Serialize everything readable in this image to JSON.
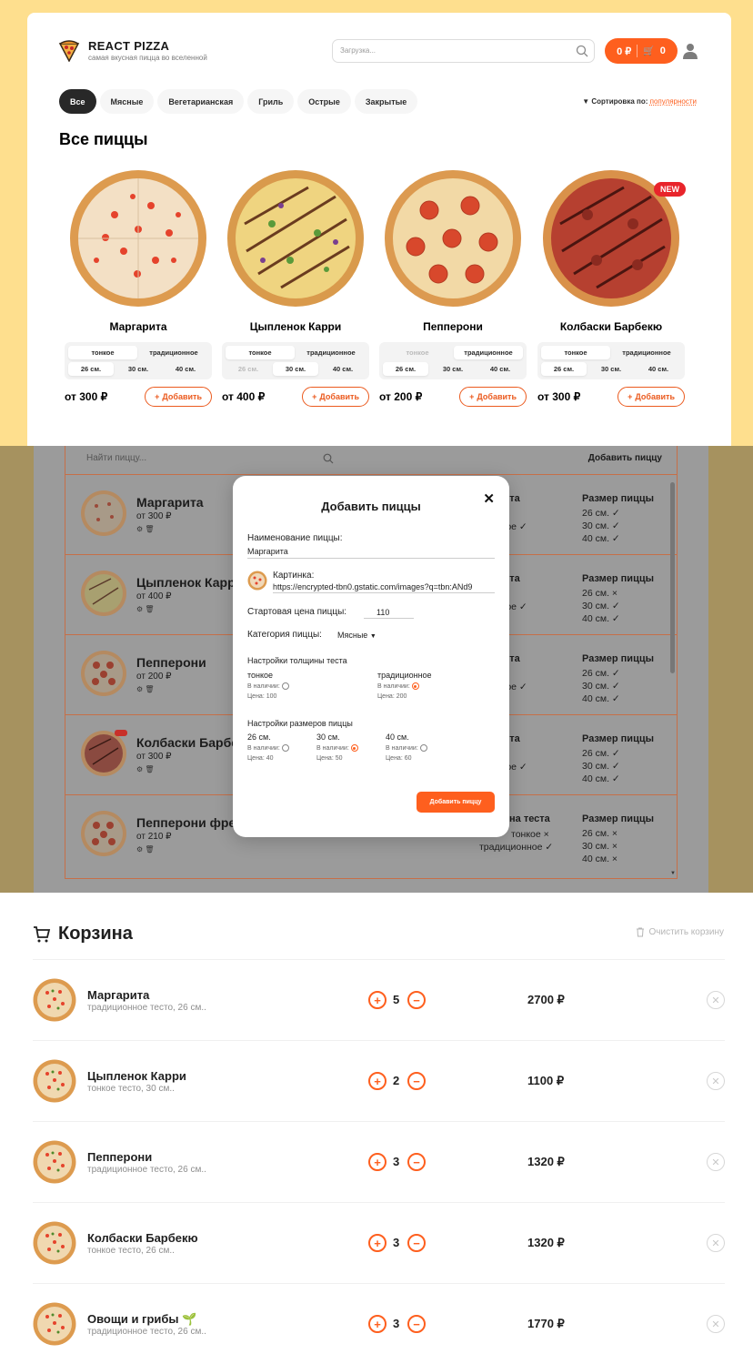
{
  "header": {
    "brand": "REACT PIZZA",
    "tagline": "самая вкусная пицца во вселенной",
    "search_placeholder": "Загрузка...",
    "cart_total": "0 ₽",
    "cart_count": "0"
  },
  "categories": [
    "Все",
    "Мясные",
    "Вегетарианская",
    "Гриль",
    "Острые",
    "Закрытые"
  ],
  "sort": {
    "label": "Сортировка по:",
    "value": "популярности"
  },
  "page_title": "Все пиццы",
  "pizzas": [
    {
      "name": "Маргарита",
      "types": [
        "тонкое",
        "традиционное"
      ],
      "sizes": [
        "26 см.",
        "30 см.",
        "40 см."
      ],
      "price": "от 300 ₽",
      "add": "Добавить"
    },
    {
      "name": "Цыпленок Карри",
      "types": [
        "тонкое",
        "традиционное"
      ],
      "sizes": [
        "26 см.",
        "30 см.",
        "40 см."
      ],
      "price": "от 400 ₽",
      "add": "Добавить"
    },
    {
      "name": "Пепперони",
      "types": [
        "тонкое",
        "традиционное"
      ],
      "sizes": [
        "26 см.",
        "30 см.",
        "40 см."
      ],
      "price": "от 200 ₽",
      "add": "Добавить"
    },
    {
      "name": "Колбаски Барбекю",
      "types": [
        "тонкое",
        "традиционное"
      ],
      "sizes": [
        "26 см.",
        "30 см.",
        "40 см."
      ],
      "price": "от 300 ₽",
      "add": "Добавить",
      "badge": "NEW"
    }
  ],
  "admin": {
    "search_placeholder": "Найти пиццу...",
    "add_button": "Добавить пиццу",
    "dough_header": "на теста",
    "size_header": "Размер пиццы",
    "rows": [
      {
        "name": "Маргарита",
        "price": "от 300 ₽",
        "dough": [
          "✓",
          "ционное ✓"
        ],
        "sizes": [
          "26 см. ✓",
          "30 см. ✓",
          "40 см. ✓"
        ]
      },
      {
        "name": "Цыпленок Карр",
        "price": "от 400 ₽",
        "dough": [
          "✓",
          "ционное ✓"
        ],
        "sizes": [
          "26 см. ×",
          "30 см. ✓",
          "40 см. ✓"
        ]
      },
      {
        "name": "Пепперони",
        "price": "от 200 ₽",
        "dough": [
          "×",
          "ционное ✓"
        ],
        "sizes": [
          "26 см. ✓",
          "30 см. ✓",
          "40 см. ✓"
        ]
      },
      {
        "name": "Колбаски Барбе",
        "price": "от 300 ₽",
        "dough": [
          "✓",
          "ционное ✓"
        ],
        "sizes": [
          "26 см. ✓",
          "30 см. ✓",
          "40 см. ✓"
        ]
      },
      {
        "name": "Пепперони фре",
        "price": "от 210 ₽",
        "dough": [
          "тонкое ×",
          "традиционное ✓"
        ],
        "sizes": [
          "26 см. ×",
          "30 см. ×",
          "40 см. ×"
        ]
      }
    ]
  },
  "modal": {
    "title": "Добавить пиццы",
    "name_label": "Наименование пиццы:",
    "name_value": "Маргарита",
    "image_label": "Картинка:",
    "image_value": "https://encrypted-tbn0.gstatic.com/images?q=tbn:ANd9",
    "price_label": "Стартовая цена пиццы:",
    "price_value": "110",
    "category_label": "Категория пиццы:",
    "category_value": "Мясные",
    "dough_label": "Настройки толщины теста",
    "dough": [
      {
        "name": "тонкое",
        "avail": "В наличии:",
        "price": "Цена: 100",
        "checked": false
      },
      {
        "name": "традиционное",
        "avail": "В наличии:",
        "price": "Цена: 200",
        "checked": true
      }
    ],
    "size_label": "Настройки размеров пиццы",
    "sizes": [
      {
        "name": "26 см.",
        "avail": "В наличии:",
        "price": "Цена: 40",
        "checked": false
      },
      {
        "name": "30 см.",
        "avail": "В наличии:",
        "price": "Цена: 50",
        "checked": true
      },
      {
        "name": "40 см.",
        "avail": "В наличии:",
        "price": "Цена: 60",
        "checked": false
      }
    ],
    "submit": "Добавить пиццу"
  },
  "cart": {
    "title": "Корзина",
    "clear": "Очистить корзину",
    "items": [
      {
        "name": "Маргарита",
        "desc": "традиционное тесто, 26 см..",
        "qty": "5",
        "price": "2700 ₽"
      },
      {
        "name": "Цыпленок Карри",
        "desc": "тонкое тесто, 30 см..",
        "qty": "2",
        "price": "1100 ₽"
      },
      {
        "name": "Пепперони",
        "desc": "традиционное тесто, 26 см..",
        "qty": "3",
        "price": "1320 ₽"
      },
      {
        "name": "Колбаски Барбекю",
        "desc": "тонкое тесто, 26 см..",
        "qty": "3",
        "price": "1320 ₽"
      },
      {
        "name": "Овощи и грибы 🌱",
        "desc": "традиционное тесто, 26 см..",
        "qty": "3",
        "price": "1770 ₽"
      }
    ]
  },
  "colors": {
    "accent": "#fe5f1e",
    "bg_yellow": "#fedf8e",
    "new_badge": "#e8242b"
  }
}
